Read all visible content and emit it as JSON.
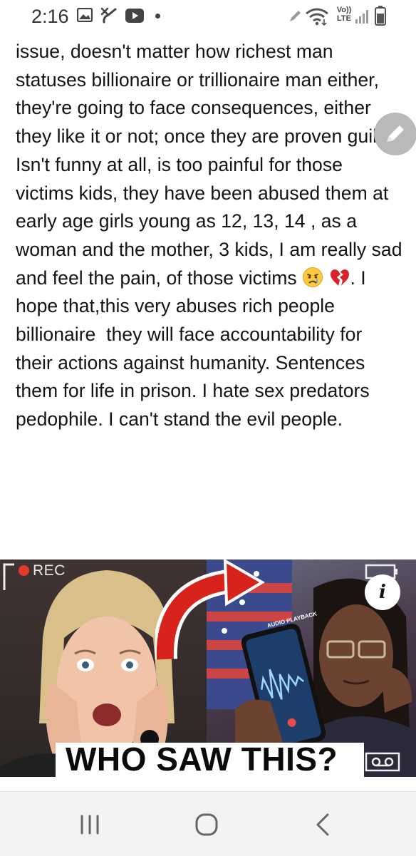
{
  "status_bar": {
    "time": "2:16",
    "icons": [
      "gallery-icon",
      "missed-call-icon",
      "youtube-icon",
      "notification-dot",
      "pen-icon",
      "wifi-icon",
      "volte-lte-icon",
      "signal-icon",
      "battery-icon"
    ],
    "volte_label": "Vo))",
    "lte_label": "LTE"
  },
  "post": {
    "text_before_emoji": "issue, doesn't matter how richest man statuses billionaire or trillionaire man either, they're going to face consequences, either they like it or not; once they are proven guilty. Isn't funny at all, is too painful for those victims kids, they have been abused them at early age girls young as 12, 13, 14 , as a woman and the mother, 3 kids, I am really sad and feel the pain, of those victims ",
    "text_after_emoji": ". I hope that,this very abuses rich people billionaire  they will face accountability for their actions against humanity. Sentences them for life in prison. I hate sex predators pedophile. I can't stand the evil people."
  },
  "edit_button": {
    "icon": "pencil-icon"
  },
  "thumbnail": {
    "rec_label": "REC",
    "headline": "WHO SAW THIS?",
    "info_label": "i",
    "phone_screen_label": "AUDIO PLAYBACK"
  },
  "nav_bar": {
    "items": [
      "recent-apps-button",
      "home-button",
      "back-button"
    ]
  },
  "colors": {
    "rec_red": "#e23b2c",
    "arrow_red": "#d8231d",
    "fab_gray": "#b9b9b9",
    "nav_bg": "#f3f3f3"
  }
}
